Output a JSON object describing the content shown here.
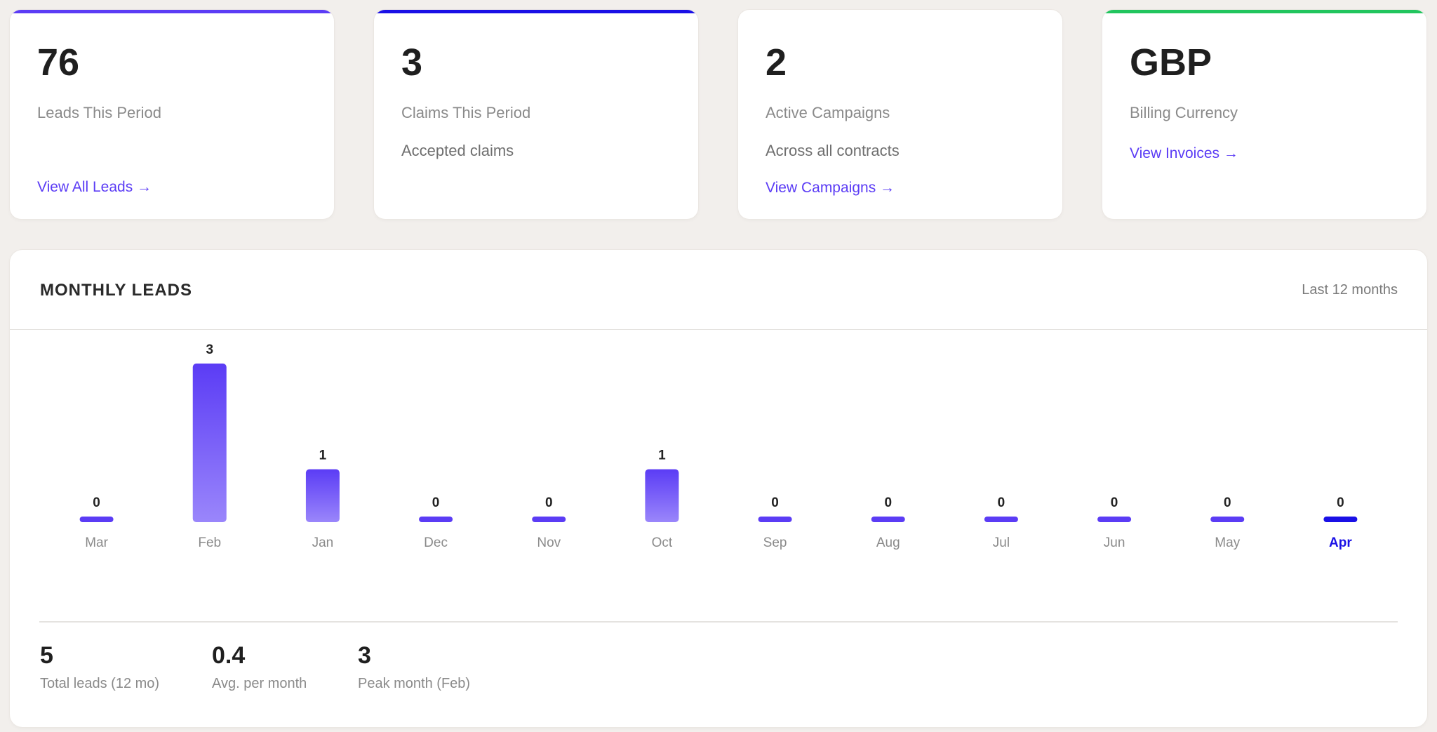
{
  "stats": [
    {
      "value": "76",
      "label": "Leads This Period",
      "sub": "",
      "link": "View All Leads →",
      "accent": "#5b3cf5"
    },
    {
      "value": "3",
      "label": "Claims This Period",
      "sub": "Accepted claims",
      "link": "",
      "accent": "#1a10e6"
    },
    {
      "value": "2",
      "label": "Active Campaigns",
      "sub": "Across all contracts",
      "link": "View Campaigns →",
      "accent": ""
    },
    {
      "value": "GBP",
      "label": "Billing Currency",
      "sub": "",
      "link": "View Invoices →",
      "accent": "#22c55e"
    }
  ],
  "monthly": {
    "title": "MONTHLY LEADS",
    "range_label": "Last 12 months",
    "highlight_color": "#1a10e6",
    "bar_color": "#5b3cf5"
  },
  "chart_data": {
    "type": "bar",
    "categories": [
      "Mar",
      "Feb",
      "Jan",
      "Dec",
      "Nov",
      "Oct",
      "Sep",
      "Aug",
      "Jul",
      "Jun",
      "May",
      "Apr"
    ],
    "values": [
      0,
      3,
      1,
      0,
      0,
      1,
      0,
      0,
      0,
      0,
      0,
      0
    ],
    "highlighted_category": "Apr",
    "data_labels": true,
    "grid": false,
    "title": "",
    "xlabel": "",
    "ylabel": "",
    "ylim": [
      0,
      3
    ]
  },
  "summary": [
    {
      "value": "5",
      "label": "Total leads (12 mo)"
    },
    {
      "value": "0.4",
      "label": "Avg. per month"
    },
    {
      "value": "3",
      "label": "Peak month (Feb)"
    }
  ]
}
